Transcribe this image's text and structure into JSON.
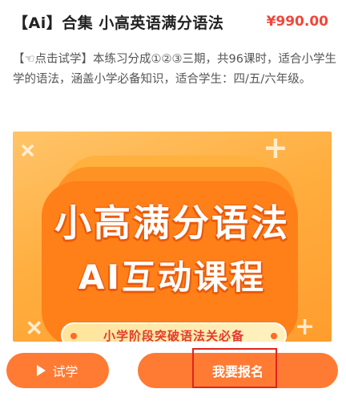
{
  "course": {
    "title": "【Ai】合集 小高英语满分语法",
    "price": "¥990.00",
    "description": "【☜点击试学】本练习分成①②③三期，共96课时，适合小学生学的语法，涵盖小学必备知识，适合学生：四/五/六年级。"
  },
  "banner": {
    "line1": "小高满分语法",
    "line2": "AI互动课程",
    "tagline": "小学阶段突破语法关必备"
  },
  "actions": {
    "trial_label": "试学",
    "enroll_label": "我要报名",
    "trial_icon": "play-icon"
  },
  "colors": {
    "price": "#f0473a",
    "button": "#ff7a33",
    "highlight": "#e0251e"
  }
}
